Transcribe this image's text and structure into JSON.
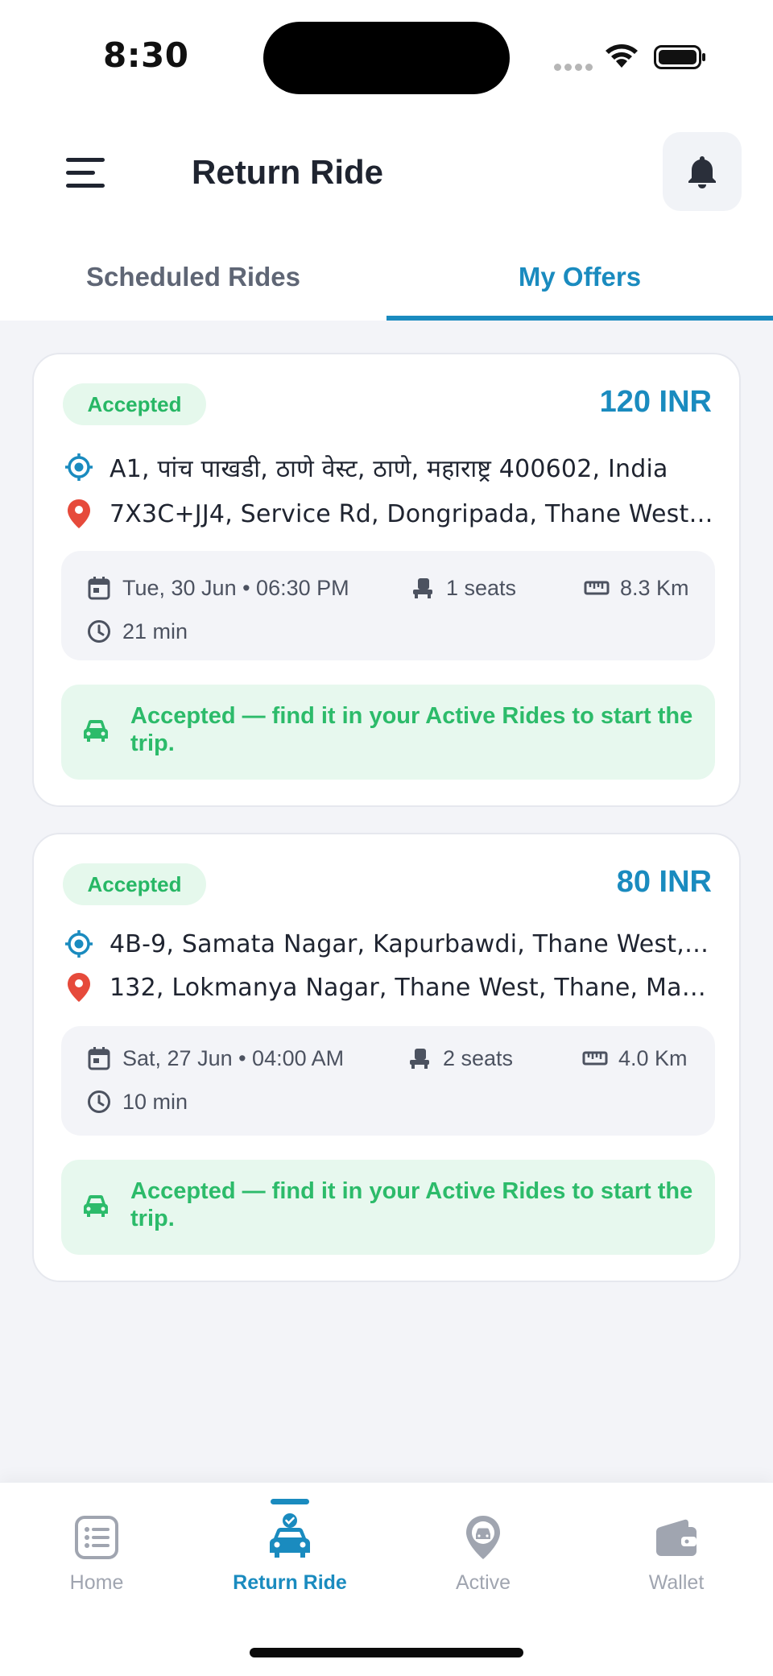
{
  "status_bar": {
    "time": "8:30"
  },
  "header": {
    "title": "Return Ride",
    "menu_icon": "hamburger-icon",
    "bell_icon": "bell-icon"
  },
  "tabs": [
    {
      "label": "Scheduled Rides",
      "active": false
    },
    {
      "label": "My Offers",
      "active": true
    }
  ],
  "offers": [
    {
      "status": "Accepted",
      "price": "120 INR",
      "pickup": "A1, पांच पाखडी, ठाणे वेस्ट, ठाणे, महाराष्ट्र 400602, India",
      "dropoff": "7X3C+JJ4, Service Rd, Dongripada, Thane West,...",
      "datetime": "Tue, 30 Jun • 06:30 PM",
      "seats": "1 seats",
      "distance": "8.3 Km",
      "duration": "21 min",
      "info": "Accepted — find it in your Active Rides to start the trip."
    },
    {
      "status": "Accepted",
      "price": "80 INR",
      "pickup": "4B-9, Samata Nagar, Kapurbawdi, Thane West, T...",
      "dropoff": "132, Lokmanya Nagar, Thane West, Thane, Maha...",
      "datetime": "Sat, 27 Jun • 04:00 AM",
      "seats": "2 seats",
      "distance": "4.0 Km",
      "duration": "10 min",
      "info": "Accepted — find it in your Active Rides to start the trip."
    }
  ],
  "bottom_nav": [
    {
      "label": "Home",
      "icon": "list-icon",
      "active": false
    },
    {
      "label": "Return Ride",
      "icon": "car-check-icon",
      "active": true
    },
    {
      "label": "Active",
      "icon": "location-car-icon",
      "active": false
    },
    {
      "label": "Wallet",
      "icon": "wallet-icon",
      "active": false
    }
  ],
  "colors": {
    "accent": "#1a8bbf",
    "success": "#27b765",
    "success_bg": "#e7f8ee",
    "background": "#f3f4f8",
    "pin_red": "#e64a3b"
  }
}
